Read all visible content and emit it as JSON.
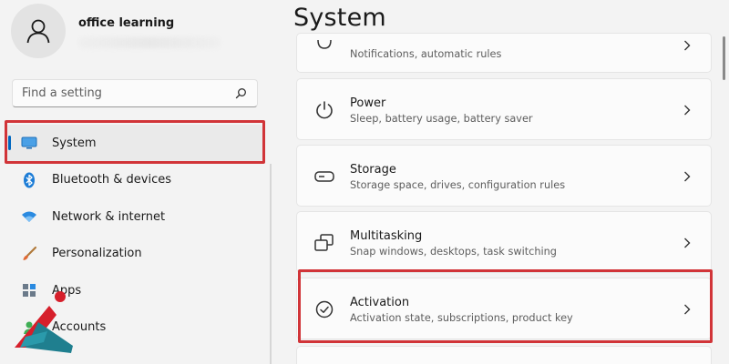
{
  "profile": {
    "name": "office learning"
  },
  "search": {
    "placeholder": "Find a setting"
  },
  "sidebar": {
    "items": [
      {
        "label": "System",
        "icon": "system-icon",
        "selected": true
      },
      {
        "label": "Bluetooth & devices",
        "icon": "bluetooth-icon"
      },
      {
        "label": "Network & internet",
        "icon": "wifi-icon"
      },
      {
        "label": "Personalization",
        "icon": "brush-icon"
      },
      {
        "label": "Apps",
        "icon": "apps-icon"
      },
      {
        "label": "Accounts",
        "icon": "accounts-icon"
      }
    ]
  },
  "main": {
    "title": "System",
    "cards": [
      {
        "title": "",
        "subtitle": "Notifications, automatic rules",
        "icon": "notifications-icon"
      },
      {
        "title": "Power",
        "subtitle": "Sleep, battery usage, battery saver",
        "icon": "power-icon"
      },
      {
        "title": "Storage",
        "subtitle": "Storage space, drives, configuration rules",
        "icon": "storage-icon"
      },
      {
        "title": "Multitasking",
        "subtitle": "Snap windows, desktops, task switching",
        "icon": "multitasking-icon"
      },
      {
        "title": "Activation",
        "subtitle": "Activation state, subscriptions, product key",
        "icon": "activation-icon"
      }
    ]
  },
  "colors": {
    "accent": "#0067c0",
    "highlight": "#d13438",
    "background": "#f3f3f3",
    "card": "#fbfbfb"
  }
}
